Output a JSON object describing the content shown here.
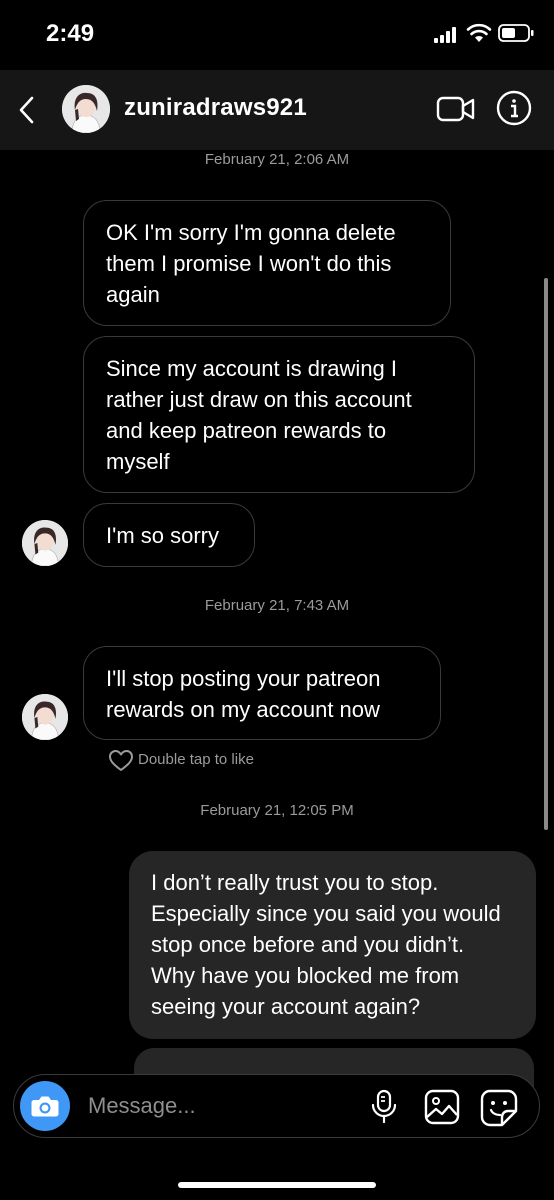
{
  "status_bar": {
    "time": "2:49"
  },
  "header": {
    "username": "zuniradraws921",
    "icons": {
      "back": "chevron-left-icon",
      "video": "video-camera-icon",
      "info": "info-icon"
    }
  },
  "thread": {
    "timestamps": [
      "February 21, 2:06 AM",
      "February 21, 7:43 AM",
      "February 21, 12:05 PM"
    ],
    "messages": [
      {
        "text": "OK I'm sorry I'm gonna delete them I promise I won't do this again"
      },
      {
        "text": "Since my account is drawing I rather just draw on this account and keep patreon rewards to myself"
      },
      {
        "text": "I'm so sorry"
      },
      {
        "text": "I'll stop posting your patreon rewards on my account now"
      },
      {
        "text": "I don’t really trust you to stop. Especially since you said you would stop once before and you didn’t. Why have you blocked me from seeing your account again?"
      }
    ],
    "like_hint": "Double tap to like"
  },
  "composer": {
    "placeholder": "Message...",
    "icons": {
      "camera": "camera-icon",
      "mic": "microphone-icon",
      "gallery": "gallery-icon",
      "sticker": "sticker-icon"
    }
  },
  "colors": {
    "background": "#000000",
    "header": "#161616",
    "outgoing_bubble": "#262626",
    "camera_button": "#3f97f6",
    "muted_text": "#9b9b9b"
  }
}
